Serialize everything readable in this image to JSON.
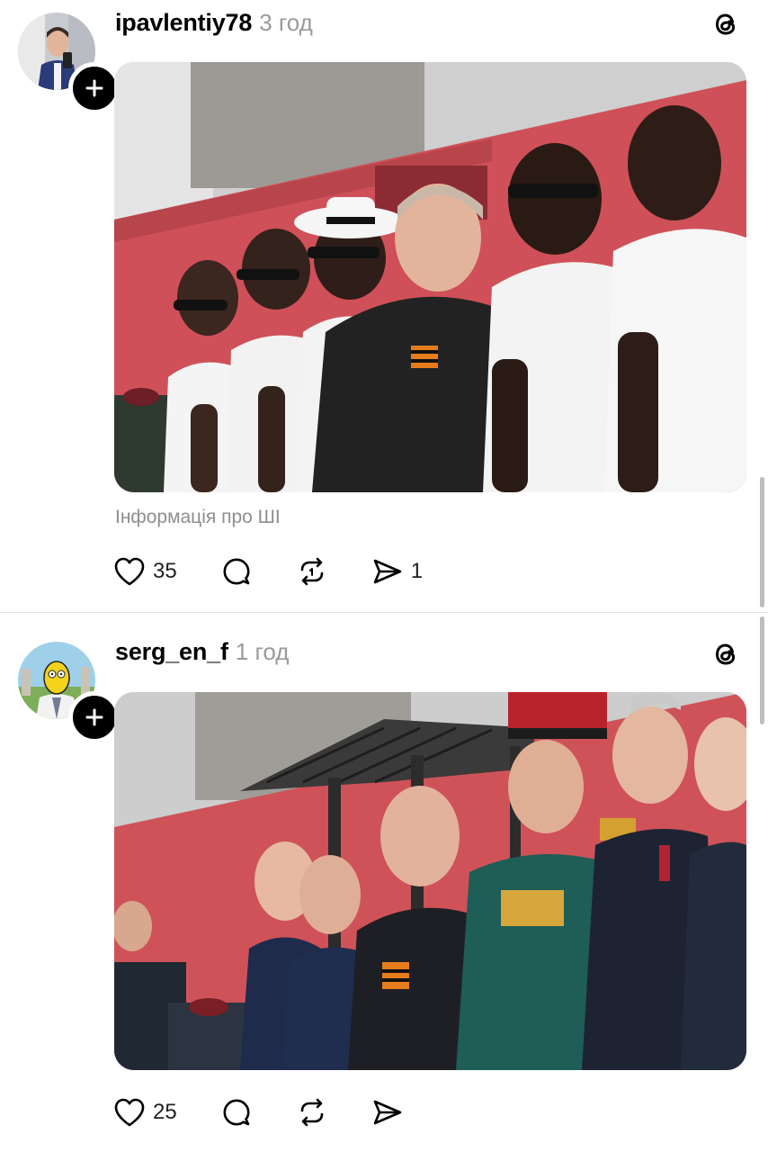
{
  "posts": [
    {
      "username": "ipavlentiy78",
      "time": "3 год",
      "ai_label": "Інформація про ШІ",
      "likes": "35",
      "shares": "1",
      "avatar_icon": "user-avatar-photo",
      "image_desc_icon": "photo-parade-tribune"
    },
    {
      "username": "serg_en_f",
      "time": "1 год",
      "likes": "25",
      "avatar_icon": "user-avatar-cartoon",
      "image_desc_icon": "photo-parade-tribune"
    }
  ],
  "icons": {
    "like": "heart-icon",
    "comment": "comment-icon",
    "repost": "repost-icon",
    "share": "send-icon",
    "app": "threads-icon",
    "follow": "plus-icon"
  },
  "colors": {
    "text": "#000000",
    "muted": "#9a9a9a",
    "divider": "#e3e3e3",
    "photo_wall": "#c94f55"
  }
}
